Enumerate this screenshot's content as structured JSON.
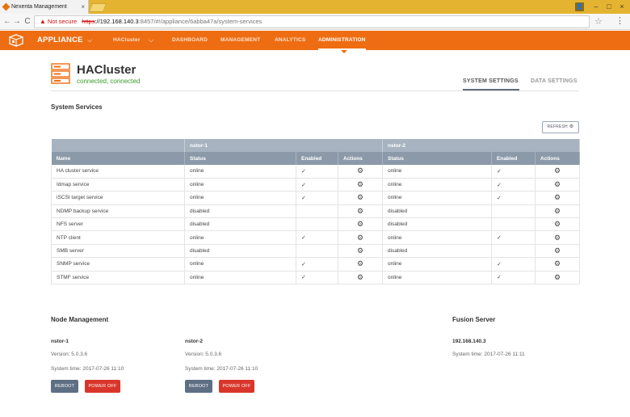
{
  "browser": {
    "tab_title": "Nexenta Management",
    "tab_close": "×",
    "not_secure": "Not secure",
    "url_scheme": "https",
    "url_host": "://192.168.140.3",
    "url_path": ":8457/#!/appliance/6abba47a/system-services",
    "back": "←",
    "forward": "→",
    "reload": "C",
    "star": "☆",
    "menu": "⋮",
    "minimize": "–",
    "maximize": "□",
    "close": "×"
  },
  "appbar": {
    "app_name": "APPLIANCE",
    "cluster_nav": "HACluster",
    "nav": [
      "DASHBOARD",
      "MANAGEMENT",
      "ANALYTICS",
      "ADMINISTRATION"
    ],
    "active_nav": "ADMINISTRATION",
    "accent_color": "#ee6d12"
  },
  "cluster": {
    "name": "HACluster",
    "status": "connected, connected"
  },
  "page_tabs": {
    "system_settings": "SYSTEM SETTINGS",
    "data_settings": "DATA SETTINGS"
  },
  "services": {
    "title": "System Services",
    "refresh_label": "REFRESH",
    "node1": "nstor-1",
    "node2": "nstor-2",
    "col_name": "Name",
    "col_status": "Status",
    "col_enabled": "Enabled",
    "col_actions": "Actions",
    "rows": [
      {
        "name": "HA cluster service",
        "s1": "online",
        "e1": true,
        "s2": "online",
        "e2": true
      },
      {
        "name": "Idmap service",
        "s1": "online",
        "e1": true,
        "s2": "online",
        "e2": true
      },
      {
        "name": "iSCSI target service",
        "s1": "online",
        "e1": true,
        "s2": "online",
        "e2": true
      },
      {
        "name": "NDMP backup service",
        "s1": "disabled",
        "e1": false,
        "s2": "disabled",
        "e2": false
      },
      {
        "name": "NFS server",
        "s1": "disabled",
        "e1": false,
        "s2": "disabled",
        "e2": false
      },
      {
        "name": "NTP client",
        "s1": "online",
        "e1": true,
        "s2": "online",
        "e2": true
      },
      {
        "name": "SMB server",
        "s1": "disabled",
        "e1": false,
        "s2": "disabled",
        "e2": false
      },
      {
        "name": "SNMP service",
        "s1": "online",
        "e1": true,
        "s2": "online",
        "e2": true
      },
      {
        "name": "STMF service",
        "s1": "online",
        "e1": true,
        "s2": "online",
        "e2": true
      }
    ]
  },
  "node_management": {
    "title": "Node Management",
    "nodes": [
      {
        "name": "nstor-1",
        "version": "Version: 5.0.3.6",
        "time": "System time: 2017-07-26 11:10",
        "reboot": "REBOOT",
        "power_off": "POWER OFF"
      },
      {
        "name": "nstor-2",
        "version": "Version: 5.0.3.6",
        "time": "System time: 2017-07-26 11:10",
        "reboot": "REBOOT",
        "power_off": "POWER OFF"
      }
    ]
  },
  "fusion_server": {
    "title": "Fusion Server",
    "ip": "192.168.140.3",
    "time": "System time: 2017-07-26 11:11"
  }
}
